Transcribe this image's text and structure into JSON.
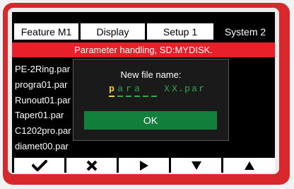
{
  "tabs": [
    {
      "label": "Feature  M1",
      "active": false
    },
    {
      "label": "Display",
      "active": false
    },
    {
      "label": "Setup 1",
      "active": false
    },
    {
      "label": "System 2",
      "active": true
    }
  ],
  "title": "Parameter handling, SD:MYDISK.",
  "files": [
    "PE-2Ring.par",
    "progra01.par",
    "Runout01.par",
    "Taper01.par",
    "C1202pro.par",
    "diamet00.par"
  ],
  "dialog": {
    "prompt": "New file name:",
    "chars": [
      "p",
      "a",
      "r",
      "a",
      "",
      "",
      "X",
      "X",
      ".",
      "p",
      "a",
      "r"
    ],
    "ok_label": "OK"
  },
  "softkeys": [
    {
      "icon": "checkmark-icon"
    },
    {
      "icon": "cross-icon"
    },
    {
      "icon": "arrow-right-icon"
    },
    {
      "icon": "arrow-down-icon"
    },
    {
      "icon": "arrow-up-icon"
    }
  ],
  "colors": {
    "bezel": "#d7282c",
    "titlebar": "#e8202a",
    "input_text": "#2fa84f",
    "cursor": "#f0d820",
    "ok_button": "#12803c"
  }
}
